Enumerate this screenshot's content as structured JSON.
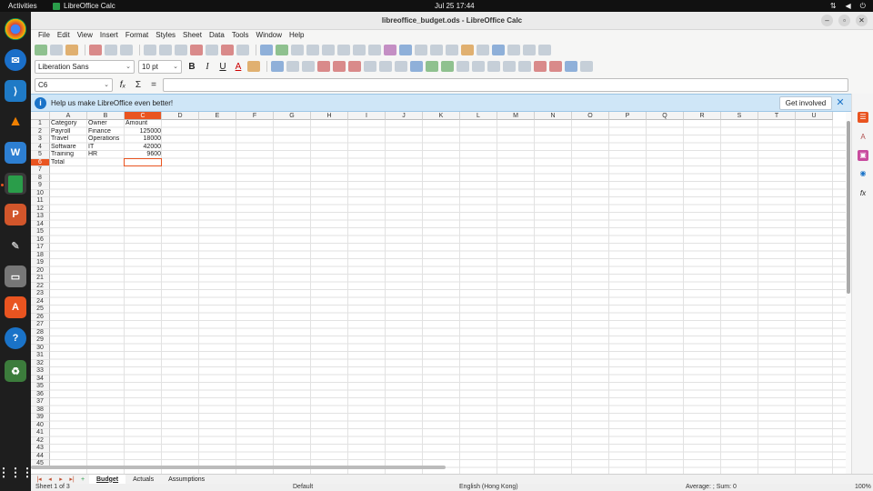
{
  "system": {
    "activities": "Activities",
    "app_name": "LibreOffice Calc",
    "clock": "Jul 25  17:44"
  },
  "window": {
    "title": "libreoffice_budget.ods - LibreOffice Calc"
  },
  "menu": [
    "File",
    "Edit",
    "View",
    "Insert",
    "Format",
    "Styles",
    "Sheet",
    "Data",
    "Tools",
    "Window",
    "Help"
  ],
  "format_bar": {
    "font_name": "Liberation Sans",
    "font_size": "10 pt"
  },
  "formula_bar": {
    "name_box": "C6",
    "fx": "fₓ",
    "sum": "Σ",
    "eq": "=",
    "content": ""
  },
  "infobar": {
    "message": "Help us make LibreOffice even better!",
    "button": "Get involved"
  },
  "columns": [
    "A",
    "B",
    "C",
    "D",
    "E",
    "F",
    "G",
    "H",
    "I",
    "J",
    "K",
    "L",
    "M",
    "N",
    "O",
    "P",
    "Q",
    "R",
    "S",
    "T",
    "U"
  ],
  "rows_count": 45,
  "cells": [
    {
      "r": 1,
      "c": 0,
      "v": "Category"
    },
    {
      "r": 1,
      "c": 1,
      "v": "Owner"
    },
    {
      "r": 1,
      "c": 2,
      "v": "Amount"
    },
    {
      "r": 2,
      "c": 0,
      "v": "Payroll"
    },
    {
      "r": 2,
      "c": 1,
      "v": "Finance"
    },
    {
      "r": 2,
      "c": 2,
      "v": "125000",
      "num": true
    },
    {
      "r": 3,
      "c": 0,
      "v": "Travel"
    },
    {
      "r": 3,
      "c": 1,
      "v": "Operations"
    },
    {
      "r": 3,
      "c": 2,
      "v": "18000",
      "num": true
    },
    {
      "r": 4,
      "c": 0,
      "v": "Software"
    },
    {
      "r": 4,
      "c": 1,
      "v": "IT"
    },
    {
      "r": 4,
      "c": 2,
      "v": "42000",
      "num": true
    },
    {
      "r": 5,
      "c": 0,
      "v": "Training"
    },
    {
      "r": 5,
      "c": 1,
      "v": "HR"
    },
    {
      "r": 5,
      "c": 2,
      "v": "9600",
      "num": true
    },
    {
      "r": 6,
      "c": 0,
      "v": "Total"
    }
  ],
  "selected": {
    "row": 6,
    "col": 2
  },
  "sheets": [
    {
      "name": "Budget",
      "active": true
    },
    {
      "name": "Actuals"
    },
    {
      "name": "Assumptions"
    }
  ],
  "status": {
    "sheet": "Sheet 1 of 3",
    "style": "Default",
    "lang": "English (Hong Kong)",
    "calc": "Average: ; Sum: 0",
    "zoom": "100%"
  },
  "colors": {
    "accent": "#e95420",
    "info": "#cfe6f7"
  }
}
